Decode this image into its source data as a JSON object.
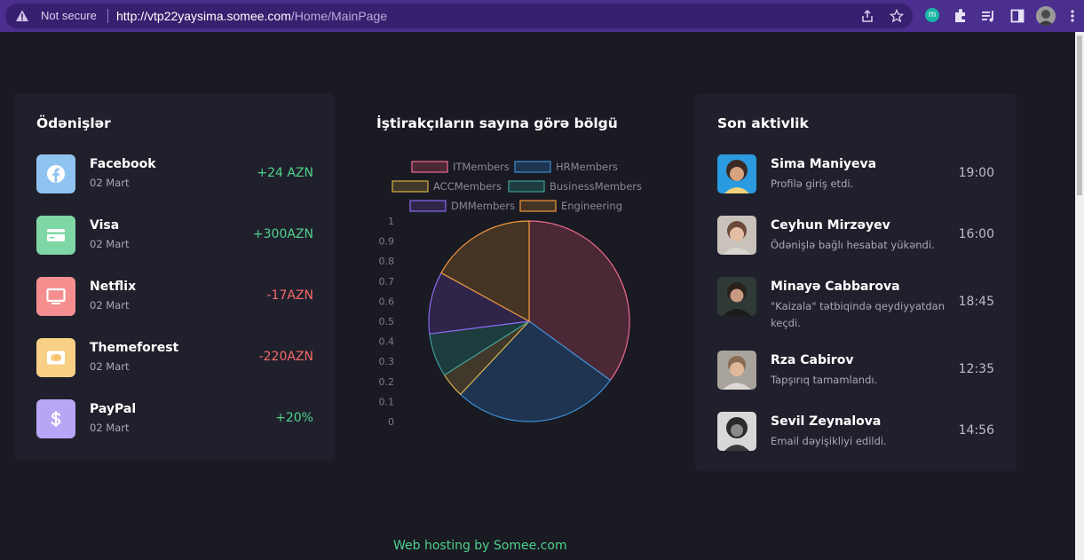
{
  "browser": {
    "security_label": "Not secure",
    "url_host": "http://vtp22yaysima.somee.com",
    "url_path": "/Home/MainPage",
    "extension_letter": "m"
  },
  "payments": {
    "title": "Ödənişlər",
    "items": [
      {
        "name": "Facebook",
        "date": "02 Mart",
        "amount": "+24 AZN",
        "icon": "facebook-icon",
        "color": "#8fc3f0"
      },
      {
        "name": "Visa",
        "date": "02 Mart",
        "amount": "+300AZN",
        "icon": "card-icon",
        "color": "#7ed7a4"
      },
      {
        "name": "Netflix",
        "date": "02 Mart",
        "amount": "-17AZN",
        "icon": "monitor-icon",
        "color": "#f58f8f"
      },
      {
        "name": "Themeforest",
        "date": "02 Mart",
        "amount": "-220AZN",
        "icon": "mastercard-icon",
        "color": "#f7cf85"
      },
      {
        "name": "PayPal",
        "date": "02 Mart",
        "amount": "+20%",
        "icon": "dollar-icon",
        "color": "#b7a6f5"
      }
    ]
  },
  "chart_data": {
    "type": "pie",
    "title": "İştirakçıların sayına görə bölgü",
    "categories": [
      "ITMembers",
      "HRMembers",
      "ACCMembers",
      "BusinessMembers",
      "DMMembers",
      "Engineering"
    ],
    "values": [
      35,
      27,
      4,
      7,
      10,
      17
    ],
    "colors": [
      "#f06a8f",
      "#3d8fd6",
      "#d7b147",
      "#3d9e9a",
      "#8b68f0",
      "#f09a3e"
    ],
    "fills": [
      "#4a2835",
      "#1e3450",
      "#40382a",
      "#1c3c3d",
      "#2e2548",
      "#453424"
    ],
    "yticks": [
      "1",
      "0.9",
      "0.8",
      "0.7",
      "0.6",
      "0.5",
      "0.4",
      "0.3",
      "0.2",
      "0.1",
      "0"
    ],
    "legend": "top"
  },
  "activity": {
    "title": "Son aktivlik",
    "items": [
      {
        "name": "Sima Maniyeva",
        "text": "Profilə giriş etdi.",
        "time": "19:00"
      },
      {
        "name": "Ceyhun Mirzəyev",
        "text": "Ödənişlə bağlı hesabat yükəndi.",
        "time": "16:00"
      },
      {
        "name": "Minayə Cabbarova",
        "text": "\"Kaizala\" tətbiqində qeydiyyatdan keçdi.",
        "time": "18:45"
      },
      {
        "name": "Rza Cabirov",
        "text": "Tapşırıq tamamlandı.",
        "time": "12:35"
      },
      {
        "name": "Sevil Zeynalova",
        "text": "Email dəyişikliyi edildi.",
        "time": "14:56"
      }
    ]
  },
  "footer": {
    "text": "Web hosting by Somee.com"
  }
}
